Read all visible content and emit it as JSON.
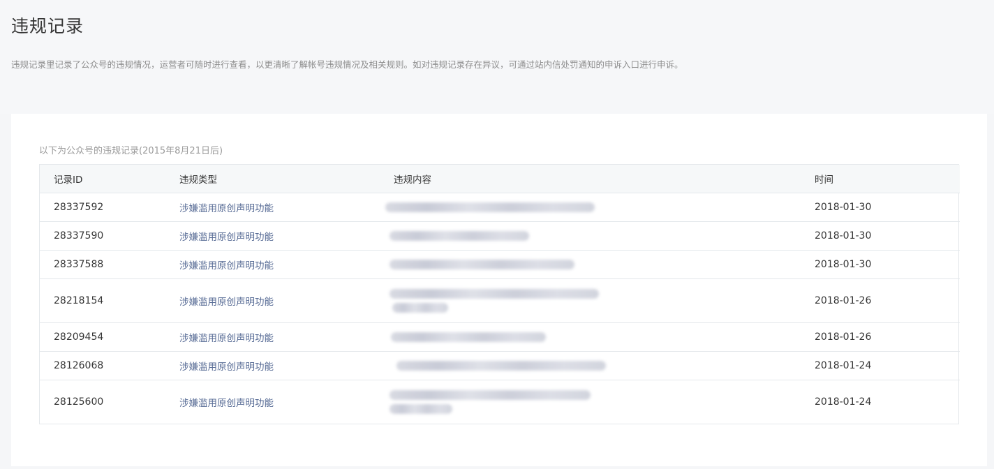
{
  "page": {
    "title": "违规记录",
    "description": "违规记录里记录了公众号的违规情况，运营者可随时进行查看，以更清晰了解帐号违规情况及相关规则。如对违规记录存在异议，可通过站内信处罚通知的申诉入口进行申诉。"
  },
  "records": {
    "caption": "以下为公众号的违规记录(2015年8月21日后)",
    "columns": [
      "记录ID",
      "违规类型",
      "违规内容",
      "时间"
    ],
    "rows": [
      {
        "id": "28337592",
        "type": "涉嫌滥用原创声明功能",
        "content": "",
        "time": "2018-01-30"
      },
      {
        "id": "28337590",
        "type": "涉嫌滥用原创声明功能",
        "content": "",
        "time": "2018-01-30"
      },
      {
        "id": "28337588",
        "type": "涉嫌滥用原创声明功能",
        "content": "",
        "time": "2018-01-30"
      },
      {
        "id": "28218154",
        "type": "涉嫌滥用原创声明功能",
        "content": "",
        "time": "2018-01-26"
      },
      {
        "id": "28209454",
        "type": "涉嫌滥用原创声明功能",
        "content": "",
        "time": "2018-01-26"
      },
      {
        "id": "28126068",
        "type": "涉嫌滥用原创声明功能",
        "content": "",
        "time": "2018-01-24"
      },
      {
        "id": "28125600",
        "type": "涉嫌滥用原创声明功能",
        "content": "",
        "time": "2018-01-24"
      }
    ]
  },
  "colors": {
    "link": "#576b95",
    "text": "#353535",
    "muted": "#8d8d8d",
    "header_bg": "#f6f8f9",
    "border": "#e4e8eb"
  }
}
